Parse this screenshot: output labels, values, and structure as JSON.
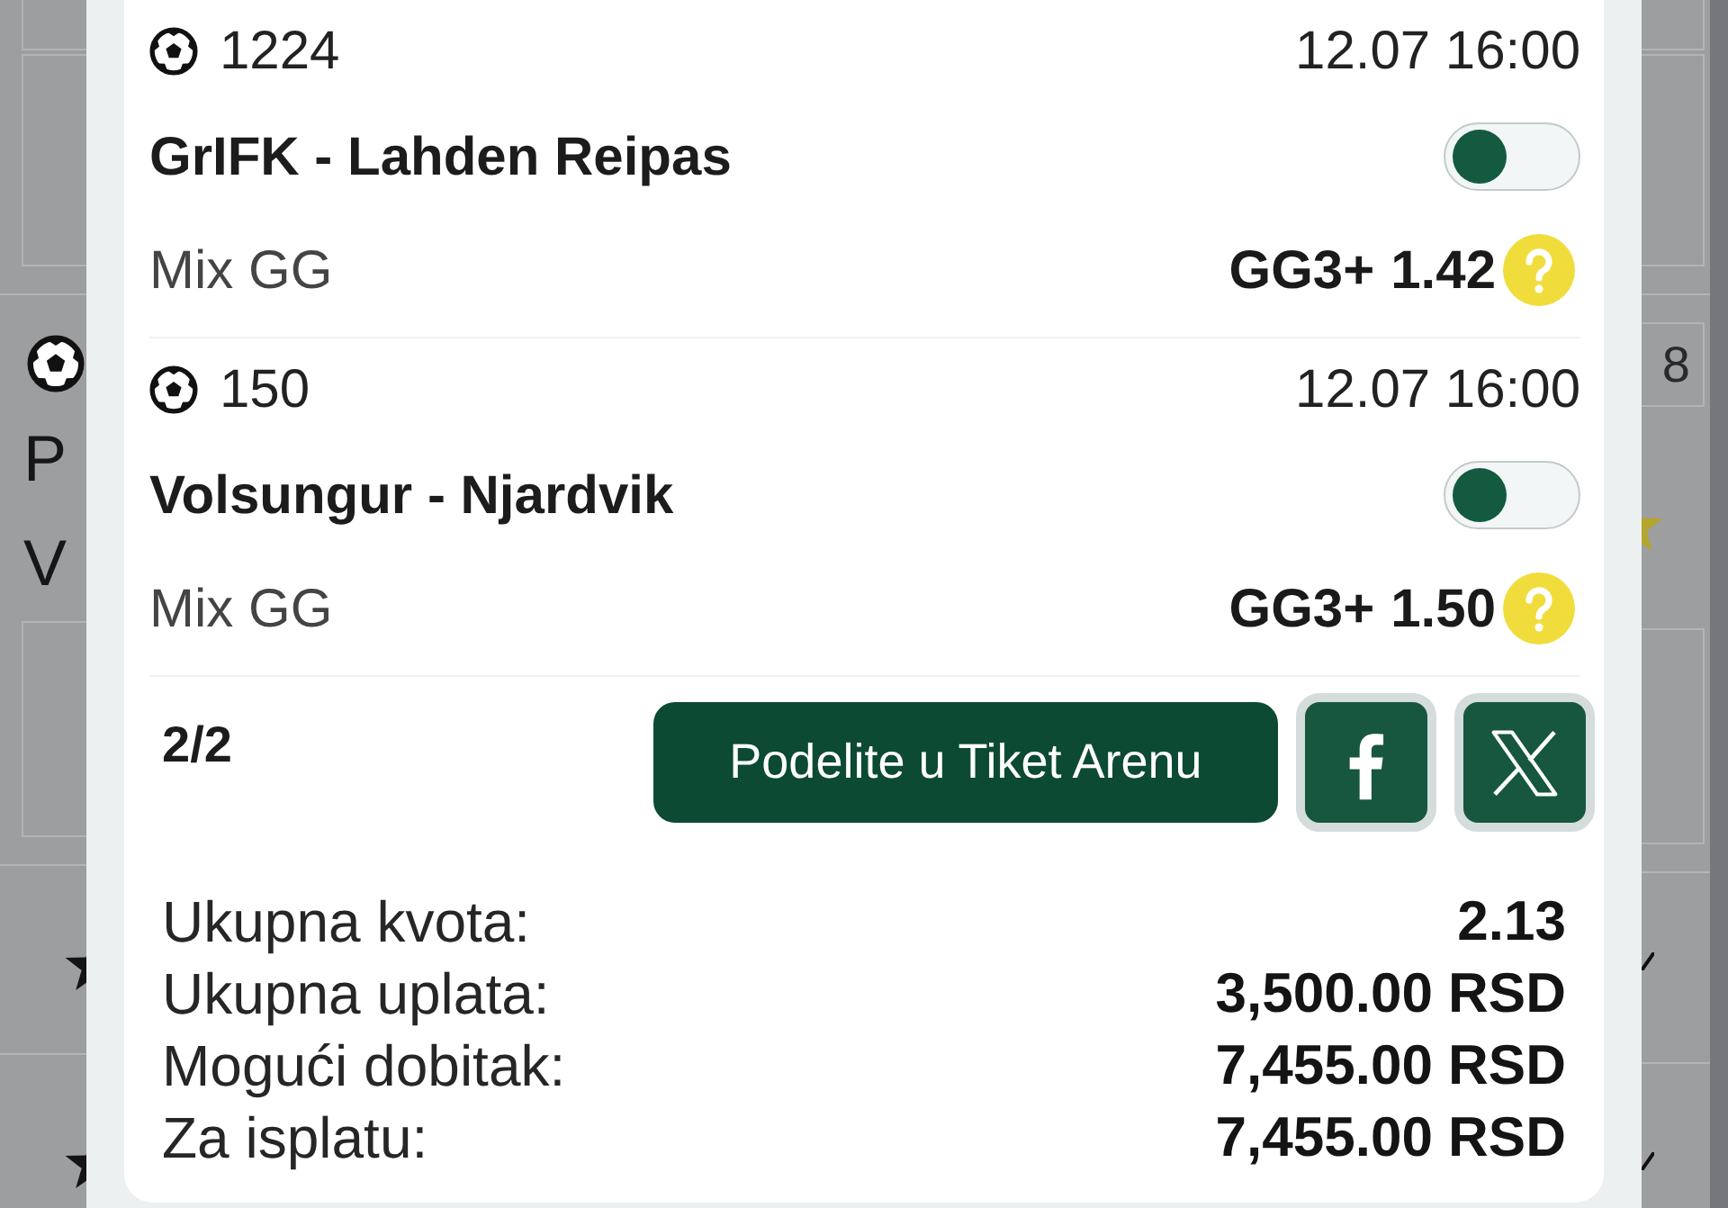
{
  "page_behind": {
    "left_edge": {
      "lines": [
        "P",
        "V"
      ]
    },
    "right_edge": {
      "count": "8"
    }
  },
  "ticket": {
    "events": [
      {
        "code": "1224",
        "datetime": "12.07 16:00",
        "teams": "GrIFK - Lahden Reipas",
        "toggled": false,
        "market": "Mix GG",
        "selection": "GG3+",
        "odds": "1.42"
      },
      {
        "code": "150",
        "datetime": "12.07 16:00",
        "teams": "Volsungur - Njardvik",
        "toggled": false,
        "market": "Mix GG",
        "selection": "GG3+",
        "odds": "1.50"
      }
    ],
    "page_indicator": "2/2",
    "share_button": "Podelite u Tiket Arenu",
    "summary": [
      {
        "label": "Ukupna kvota:",
        "value": "2.13"
      },
      {
        "label": "Ukupna uplata:",
        "value": "3,500.00 RSD"
      },
      {
        "label": "Mogući dobitak:",
        "value": "7,455.00 RSD"
      },
      {
        "label": "Za isplatu:",
        "value": "7,455.00 RSD"
      }
    ]
  }
}
